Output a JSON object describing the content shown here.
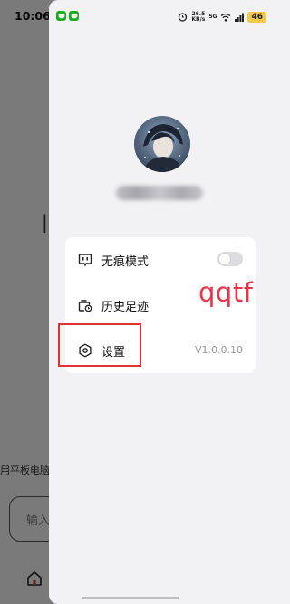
{
  "status_bar": {
    "time": "10:06",
    "speed_value": "26.5",
    "speed_unit": "KB/s",
    "network": "5G",
    "battery": "46"
  },
  "background": {
    "device_text": "用平板电脑",
    "input_placeholder": "输入"
  },
  "drawer": {
    "menu": {
      "incognito_label": "无痕模式",
      "incognito_enabled": false,
      "history_label": "历史足迹",
      "settings_label": "设置",
      "version": "V1.0.0.10"
    }
  },
  "annotation": {
    "text": "qqtf",
    "color": "#e8364a"
  },
  "icons": [
    "incognito-icon",
    "history-icon",
    "settings-icon",
    "home-icon",
    "alarm-icon",
    "wifi-icon",
    "signal-icon"
  ]
}
